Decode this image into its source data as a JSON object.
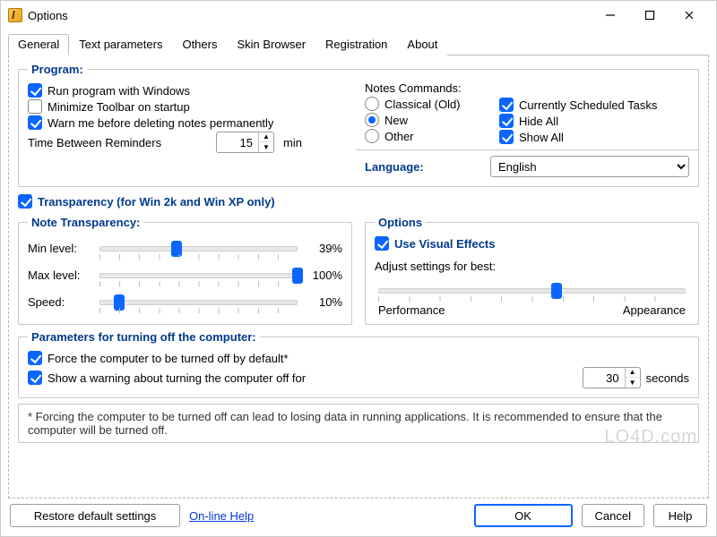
{
  "window": {
    "title": "Options"
  },
  "tabs": {
    "general": "General",
    "text_params": "Text parameters",
    "others": "Others",
    "skin_browser": "Skin Browser",
    "registration": "Registration",
    "about": "About"
  },
  "program": {
    "legend": "Program:",
    "run_with_windows": "Run program with Windows",
    "minimize_on_startup": "Minimize Toolbar on startup",
    "warn_delete": "Warn me before deleting notes permanently",
    "reminder_label": "Time Between Reminders",
    "reminder_value": "15",
    "reminder_unit": "min"
  },
  "notes_commands": {
    "legend": "Notes Commands:",
    "classical": "Classical (Old)",
    "new": "New",
    "other": "Other",
    "currently_scheduled": "Currently Scheduled Tasks",
    "hide_all": "Hide All",
    "show_all": "Show All"
  },
  "language": {
    "label": "Language:",
    "value": "English"
  },
  "transparency_flag": "Transparency (for Win 2k and Win XP only)",
  "note_transparency": {
    "legend": "Note Transparency:",
    "min_label": "Min level:",
    "min_value": "39%",
    "max_label": "Max level:",
    "max_value": "100%",
    "speed_label": "Speed:",
    "speed_value": "10%"
  },
  "visual": {
    "legend": "Options",
    "use_effects": "Use Visual Effects",
    "adjust_label": "Adjust settings for best:",
    "performance": "Performance",
    "appearance": "Appearance"
  },
  "shutdown": {
    "legend": "Parameters for turning off the computer:",
    "force_off": "Force the computer to be turned off by default*",
    "show_warning": "Show a warning about turning the computer off for",
    "seconds_value": "30",
    "seconds_unit": "seconds"
  },
  "footnote": "* Forcing the computer to be turned off can lead to losing data in running applications. It is recommended to ensure that the computer will be turned off.",
  "buttons": {
    "restore": "Restore default settings",
    "help_link": "On-line Help",
    "ok": "OK",
    "cancel": "Cancel",
    "help": "Help"
  },
  "watermark": "LO4D.com"
}
